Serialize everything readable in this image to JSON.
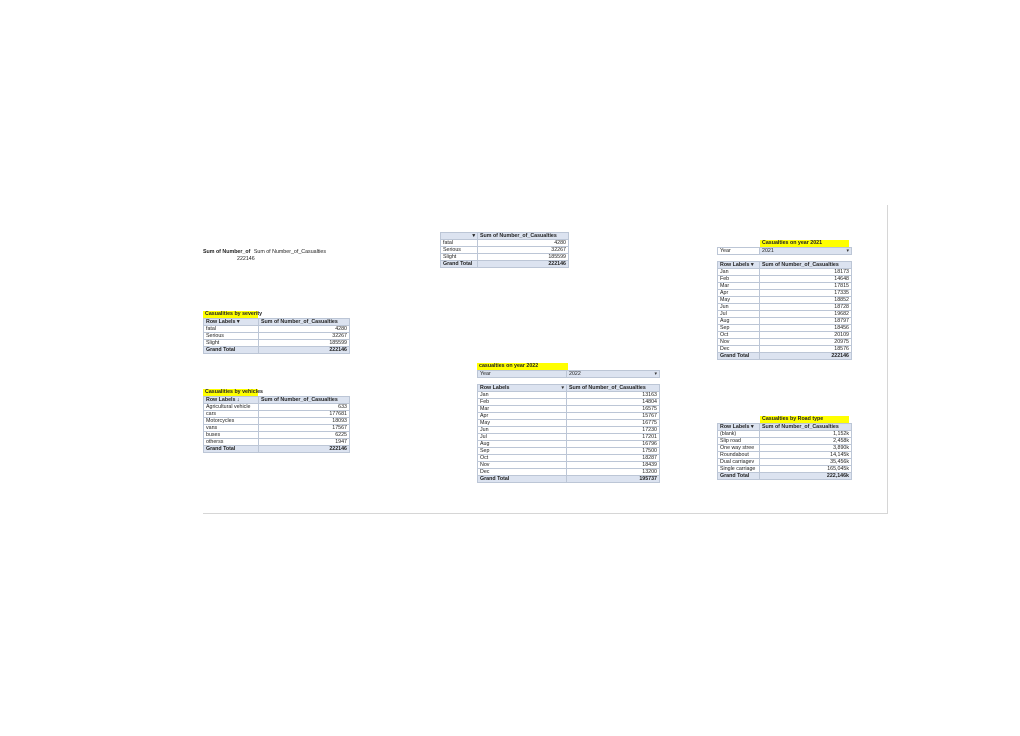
{
  "total_block": {
    "header": "Sum of Number_of",
    "overflow_label": "Sum of Number_of_Casualties",
    "value": "222146"
  },
  "top_table": {
    "arrow": "▾",
    "col_header": "Sum of Number_of_Casualties",
    "rows": [
      [
        "fatal",
        "4280"
      ],
      [
        "Serious",
        "32267"
      ],
      [
        "Slight",
        "185599"
      ]
    ],
    "total": [
      "Grand Total",
      "222146"
    ]
  },
  "severity": {
    "title": "Casualities by severity",
    "headers": [
      "Row Labels ▾",
      "Sum of Number_of_Casualties"
    ],
    "rows": [
      [
        "fatal",
        "4280"
      ],
      [
        "Serious",
        "32267"
      ],
      [
        "Slight",
        "185599"
      ]
    ],
    "total": [
      "Grand Total",
      "222146"
    ]
  },
  "vehicles": {
    "title": "Casualities by vehicles",
    "headers": [
      "Row Labels ↓",
      "Sum of Number_of_Casualties"
    ],
    "rows": [
      [
        "Agricultural vehicle",
        "633"
      ],
      [
        "cars",
        "177681"
      ],
      [
        "Motorcycles",
        "18093"
      ],
      [
        "vans",
        "17567"
      ],
      [
        "buses",
        "6225"
      ],
      [
        "otherss",
        "1947"
      ]
    ],
    "total": [
      "Grand Total",
      "222146"
    ]
  },
  "year2022": {
    "title": "casualties on year 2022",
    "filter": [
      "Year",
      "2022",
      "▾"
    ],
    "headers": [
      "Row Labels",
      "▾",
      "Sum of Number_of_Casualties"
    ],
    "rows": [
      [
        "Jan",
        "13163"
      ],
      [
        "Feb",
        "14804"
      ],
      [
        "Mar",
        "16575"
      ],
      [
        "Apr",
        "15767"
      ],
      [
        "May",
        "16775"
      ],
      [
        "Jun",
        "17230"
      ],
      [
        "Jul",
        "17201"
      ],
      [
        "Aug",
        "16796"
      ],
      [
        "Sep",
        "17500"
      ],
      [
        "Oct",
        "18287"
      ],
      [
        "Nov",
        "18439"
      ],
      [
        "Dec",
        "13200"
      ]
    ],
    "total": [
      "Grand Total",
      "195737"
    ]
  },
  "year2021": {
    "title": "Casualties on year 2021",
    "filter": [
      "Year",
      "2021",
      "▾"
    ],
    "headers": [
      "Row Labels ▾",
      "Sum of Number_of_Casualties"
    ],
    "rows": [
      [
        "Jan",
        "18173"
      ],
      [
        "Feb",
        "14648"
      ],
      [
        "Mar",
        "17815"
      ],
      [
        "Apr",
        "17335"
      ],
      [
        "May",
        "18852"
      ],
      [
        "Jun",
        "18728"
      ],
      [
        "Jul",
        "19682"
      ],
      [
        "Aug",
        "18797"
      ],
      [
        "Sep",
        "18456"
      ],
      [
        "Oct",
        "20109"
      ],
      [
        "Nov",
        "20975"
      ],
      [
        "Dec",
        "18576"
      ]
    ],
    "total": [
      "Grand Total",
      "222146"
    ]
  },
  "roadtype": {
    "title": "Casualties by Road type",
    "headers": [
      "Row Labels ▾",
      "Sum of Number_of_Casualties"
    ],
    "rows": [
      [
        "(blank)",
        "1,152k"
      ],
      [
        "Slip road",
        "2,458k"
      ],
      [
        "One way stree",
        "3,890k"
      ],
      [
        "Roundabout",
        "14,145k"
      ],
      [
        "Dual carriagev",
        "35,456k"
      ],
      [
        "Single carriage",
        "165,045k"
      ]
    ],
    "total": [
      "Grand Total",
      "222,146k"
    ]
  }
}
